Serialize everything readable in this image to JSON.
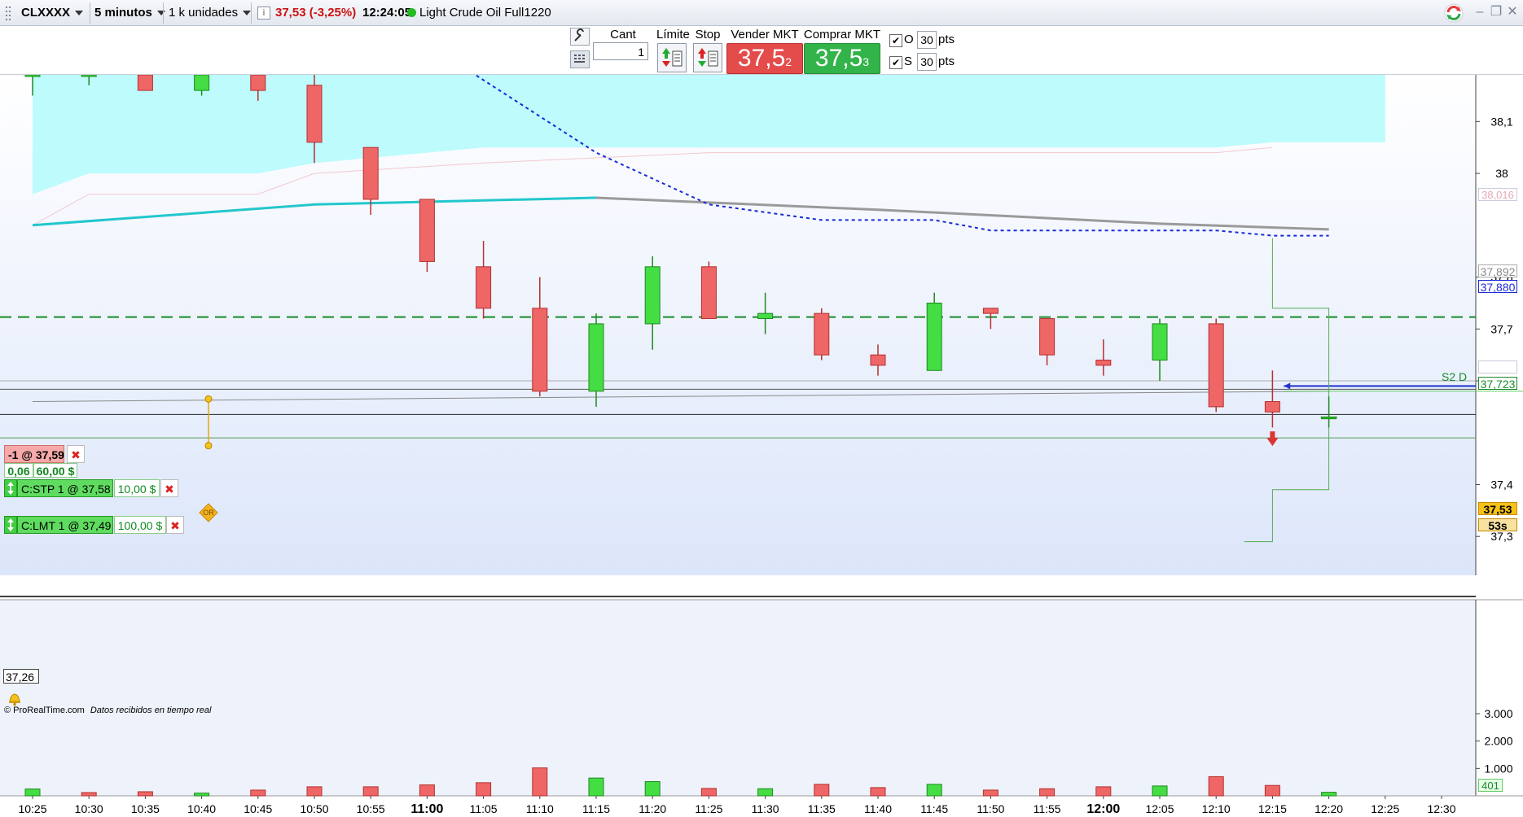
{
  "toolbar": {
    "symbol": "CLXXXX",
    "timeframe": "5 minutos",
    "units": "1 k unidades",
    "price_change": "37,53 (-3,25%)",
    "time": "12:24:05",
    "instrument_name": "Light Crude Oil Full1220",
    "status_color": "#22bb22"
  },
  "orderbar": {
    "cant_label": "Cant",
    "cant_value": "1",
    "limite_label": "Límite",
    "stop_label": "Stop",
    "sell_label": "Vender MKT",
    "buy_label": "Comprar MKT",
    "sell_main": "37,5",
    "sell_sup": "2",
    "buy_main": "37,5",
    "buy_sup": "3",
    "o_label": "O",
    "o_value": "30",
    "s_label": "S",
    "s_value": "30",
    "pts_label": "pts"
  },
  "orders": {
    "position": "-1 @ 37,59",
    "pnl_points": "0,06",
    "pnl_amount": "60,00 $",
    "stop_order": "C:STP 1 @ 37,58",
    "stop_amount": "10,00 $",
    "limit_order": "C:LMT 1 @ 37,49",
    "limit_amount": "100,00 $",
    "or_badge": "OR"
  },
  "price_axis": {
    "ticks": [
      "38,1",
      "38",
      "37,8",
      "37,7",
      "37,6",
      "37,4",
      "37,3"
    ],
    "label_38016": "38,016",
    "label_37892": "37,892",
    "label_37880": "37,880",
    "label_37723": "37,723",
    "label_current": "37,53",
    "label_countdown": "53s",
    "s2_label": "S2 D",
    "min_label": "37,26"
  },
  "volume_axis": {
    "ticks": [
      "3.000",
      "2.000",
      "1.000"
    ],
    "current": "401"
  },
  "footer": {
    "copyright": "© ProRealTime.com",
    "realtime": "Datos recibidos en tiempo real"
  },
  "colors": {
    "bull": "#44dd44",
    "bear": "#ee6666",
    "cloud": "#b9fbfd",
    "teal_ma": "#22c7cc",
    "blue_dotted": "#1a2bd6",
    "s2_line": "#1a8a2a"
  },
  "chart_data": {
    "type": "candlestick",
    "x": [
      "10:25",
      "10:30",
      "10:35",
      "10:40",
      "10:45",
      "10:50",
      "10:55",
      "11:00",
      "11:05",
      "11:10",
      "11:15",
      "11:20",
      "11:25",
      "11:30",
      "11:35",
      "11:40",
      "11:45",
      "11:50",
      "11:55",
      "12:00",
      "12:05",
      "12:10",
      "12:15",
      "12:20",
      "12:25",
      "12:30"
    ],
    "x_bold": [
      "11:00",
      "12:00"
    ],
    "ylim": [
      37.26,
      38.2
    ],
    "candles": [
      {
        "t": "10:25",
        "o": 38.2,
        "h": 38.2,
        "l": 38.15,
        "c": 38.2
      },
      {
        "t": "10:30",
        "o": 38.2,
        "h": 38.2,
        "l": 38.17,
        "c": 38.2
      },
      {
        "t": "10:35",
        "o": 38.2,
        "h": 38.2,
        "l": 38.16,
        "c": 38.17
      },
      {
        "t": "10:40",
        "o": 38.17,
        "h": 38.2,
        "l": 38.15,
        "c": 38.2
      },
      {
        "t": "10:45",
        "o": 38.2,
        "h": 38.2,
        "l": 38.14,
        "c": 38.17
      },
      {
        "t": "10:50",
        "o": 38.17,
        "h": 38.2,
        "l": 38.02,
        "c": 38.06
      },
      {
        "t": "10:55",
        "o": 38.05,
        "h": 38.05,
        "l": 37.92,
        "c": 37.95
      },
      {
        "t": "11:00",
        "o": 37.95,
        "h": 37.95,
        "l": 37.81,
        "c": 37.83
      },
      {
        "t": "11:05",
        "o": 37.82,
        "h": 37.87,
        "l": 37.72,
        "c": 37.74
      },
      {
        "t": "11:10",
        "o": 37.74,
        "h": 37.8,
        "l": 37.57,
        "c": 37.58
      },
      {
        "t": "11:15",
        "o": 37.58,
        "h": 37.73,
        "l": 37.55,
        "c": 37.71
      },
      {
        "t": "11:20",
        "o": 37.71,
        "h": 37.84,
        "l": 37.66,
        "c": 37.82
      },
      {
        "t": "11:25",
        "o": 37.82,
        "h": 37.83,
        "l": 37.72,
        "c": 37.72
      },
      {
        "t": "11:30",
        "o": 37.72,
        "h": 37.77,
        "l": 37.69,
        "c": 37.73
      },
      {
        "t": "11:35",
        "o": 37.73,
        "h": 37.74,
        "l": 37.64,
        "c": 37.65
      },
      {
        "t": "11:40",
        "o": 37.65,
        "h": 37.67,
        "l": 37.61,
        "c": 37.63
      },
      {
        "t": "11:45",
        "o": 37.62,
        "h": 37.77,
        "l": 37.62,
        "c": 37.75
      },
      {
        "t": "11:50",
        "o": 37.74,
        "h": 37.74,
        "l": 37.7,
        "c": 37.73
      },
      {
        "t": "11:55",
        "o": 37.72,
        "h": 37.72,
        "l": 37.63,
        "c": 37.65
      },
      {
        "t": "12:00",
        "o": 37.64,
        "h": 37.68,
        "l": 37.61,
        "c": 37.63
      },
      {
        "t": "12:05",
        "o": 37.64,
        "h": 37.72,
        "l": 37.6,
        "c": 37.71
      },
      {
        "t": "12:10",
        "o": 37.71,
        "h": 37.72,
        "l": 37.54,
        "c": 37.55
      },
      {
        "t": "12:15",
        "o": 37.56,
        "h": 37.62,
        "l": 37.51,
        "c": 37.54
      },
      {
        "t": "12:20",
        "o": 37.53,
        "h": 37.57,
        "l": 37.51,
        "c": 37.53
      }
    ],
    "volume": [
      {
        "t": "10:25",
        "v": 250,
        "dir": "up"
      },
      {
        "t": "10:30",
        "v": 120,
        "dir": "down"
      },
      {
        "t": "10:35",
        "v": 150,
        "dir": "down"
      },
      {
        "t": "10:40",
        "v": 100,
        "dir": "up"
      },
      {
        "t": "10:45",
        "v": 210,
        "dir": "down"
      },
      {
        "t": "10:50",
        "v": 330,
        "dir": "down"
      },
      {
        "t": "10:55",
        "v": 330,
        "dir": "down"
      },
      {
        "t": "11:00",
        "v": 400,
        "dir": "down"
      },
      {
        "t": "11:05",
        "v": 480,
        "dir": "down"
      },
      {
        "t": "11:10",
        "v": 1020,
        "dir": "down"
      },
      {
        "t": "11:15",
        "v": 650,
        "dir": "up"
      },
      {
        "t": "11:20",
        "v": 520,
        "dir": "up"
      },
      {
        "t": "11:25",
        "v": 270,
        "dir": "down"
      },
      {
        "t": "11:30",
        "v": 260,
        "dir": "up"
      },
      {
        "t": "11:35",
        "v": 420,
        "dir": "down"
      },
      {
        "t": "11:40",
        "v": 300,
        "dir": "down"
      },
      {
        "t": "11:45",
        "v": 420,
        "dir": "up"
      },
      {
        "t": "11:50",
        "v": 210,
        "dir": "down"
      },
      {
        "t": "11:55",
        "v": 260,
        "dir": "down"
      },
      {
        "t": "12:00",
        "v": 330,
        "dir": "down"
      },
      {
        "t": "12:05",
        "v": 360,
        "dir": "up"
      },
      {
        "t": "12:10",
        "v": 700,
        "dir": "down"
      },
      {
        "t": "12:15",
        "v": 380,
        "dir": "down"
      },
      {
        "t": "12:20",
        "v": 130,
        "dir": "up"
      }
    ],
    "volume_ylim": [
      0,
      3000
    ],
    "teal_ma": [
      [
        0,
        37.9
      ],
      [
        5,
        37.94
      ],
      [
        10,
        37.953
      ]
    ],
    "gray_ma": [
      [
        10,
        37.953
      ],
      [
        15,
        37.93
      ],
      [
        20,
        37.903
      ],
      [
        23,
        37.892
      ]
    ],
    "dotted_line": [
      [
        7,
        38.25
      ],
      [
        10,
        38.04
      ],
      [
        12,
        37.94
      ],
      [
        14,
        37.91
      ],
      [
        16,
        37.91
      ],
      [
        17,
        37.89
      ],
      [
        21,
        37.89
      ],
      [
        22,
        37.88
      ],
      [
        23,
        37.88
      ]
    ],
    "cloud_upper": [
      [
        0,
        38.07
      ],
      [
        2,
        38.1
      ],
      [
        5,
        38.13
      ],
      [
        8,
        38.15
      ],
      [
        23,
        38.1
      ],
      [
        24,
        38.1
      ]
    ],
    "cloud_lower": [
      [
        0,
        37.96
      ],
      [
        1,
        38.0
      ],
      [
        4,
        38.0
      ],
      [
        5,
        38.02
      ],
      [
        8,
        38.05
      ],
      [
        12,
        38.05
      ],
      [
        21,
        38.05
      ],
      [
        22,
        38.06
      ],
      [
        23,
        38.06
      ],
      [
        24,
        38.06
      ]
    ],
    "s2_level": 37.723,
    "step_line": [
      [
        22,
        37.875
      ],
      [
        22,
        37.74
      ],
      [
        23,
        37.74
      ],
      [
        23,
        37.49
      ],
      [
        23,
        37.39
      ],
      [
        22,
        37.39
      ],
      [
        22,
        37.29
      ],
      [
        21.5,
        37.29
      ]
    ],
    "green_stop_level": 37.58,
    "limit_level": 37.49,
    "position_level": 37.59,
    "pos_gray_line": [
      [
        0,
        37.56
      ],
      [
        23,
        37.58
      ]
    ]
  }
}
